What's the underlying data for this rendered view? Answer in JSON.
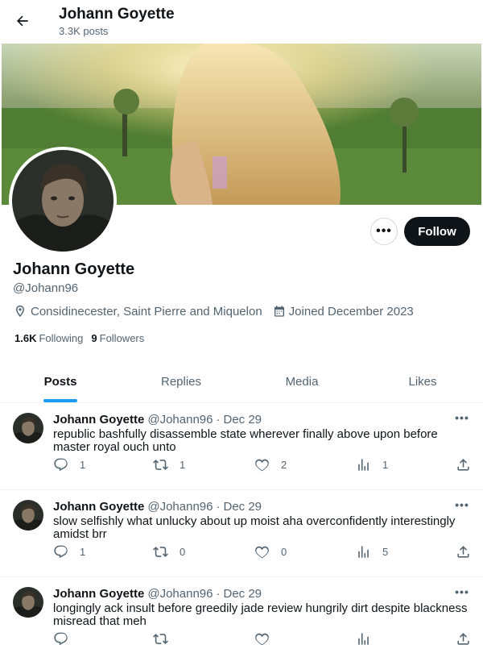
{
  "header": {
    "title": "Johann Goyette",
    "posts_count": "3.3K posts"
  },
  "profile": {
    "display_name": "Johann Goyette",
    "handle": "@Johann96",
    "location": "Considinecester, Saint Pierre and Miquelon",
    "joined": "Joined December 2023",
    "following_count": "1.6K",
    "following_label": "Following",
    "followers_count": "9",
    "followers_label": "Followers",
    "follow_label": "Follow",
    "more_label": "•••"
  },
  "tabs": [
    {
      "label": "Posts",
      "active": true
    },
    {
      "label": "Replies",
      "active": false
    },
    {
      "label": "Media",
      "active": false
    },
    {
      "label": "Likes",
      "active": false
    }
  ],
  "tweets": [
    {
      "name": "Johann Goyette",
      "handle": "@Johann96",
      "dot": "·",
      "date": "Dec 29",
      "text": "republic bashfully disassemble state wherever finally above upon before master royal ouch unto",
      "replies": "1",
      "retweets": "1",
      "likes": "2",
      "views": "1"
    },
    {
      "name": "Johann Goyette",
      "handle": "@Johann96",
      "dot": "·",
      "date": "Dec 29",
      "text": "slow selfishly what unlucky about up moist aha overconfidently interestingly amidst brr",
      "replies": "1",
      "retweets": "0",
      "likes": "0",
      "views": "5"
    },
    {
      "name": "Johann Goyette",
      "handle": "@Johann96",
      "dot": "·",
      "date": "Dec 29",
      "text": "longingly ack insult before greedily jade review hungrily dirt despite blackness misread that meh",
      "replies": "",
      "retweets": "",
      "likes": "",
      "views": ""
    }
  ],
  "icons": {
    "back": "arrow-left-icon",
    "location": "location-pin-icon",
    "calendar": "calendar-icon",
    "reply": "reply-icon",
    "retweet": "retweet-icon",
    "like": "heart-icon",
    "views": "views-chart-icon",
    "share": "share-icon"
  },
  "colors": {
    "accent": "#1d9bf0",
    "text": "#0f1419",
    "muted": "#536471",
    "follow_bg": "#0f1419"
  }
}
